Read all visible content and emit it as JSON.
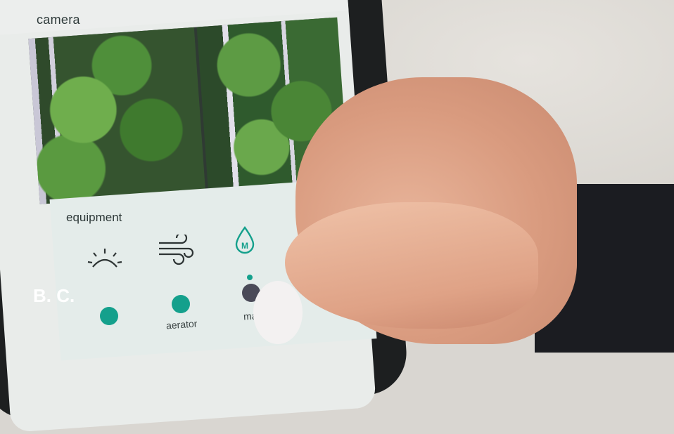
{
  "camera": {
    "title": "camera"
  },
  "equipment": {
    "title": "equipment",
    "items": [
      {
        "icon": "sun-icon",
        "label": ""
      },
      {
        "icon": "wind-icon",
        "label": "aerator"
      },
      {
        "icon": "water-drop-m-icon",
        "label": "ma"
      },
      {
        "icon": "partial-icon",
        "label": ""
      }
    ]
  },
  "overlay": {
    "caption": "B. C."
  },
  "colors": {
    "accent": "#14a08c",
    "off": "#4a4a58",
    "sleeve": "#1b1c21"
  }
}
